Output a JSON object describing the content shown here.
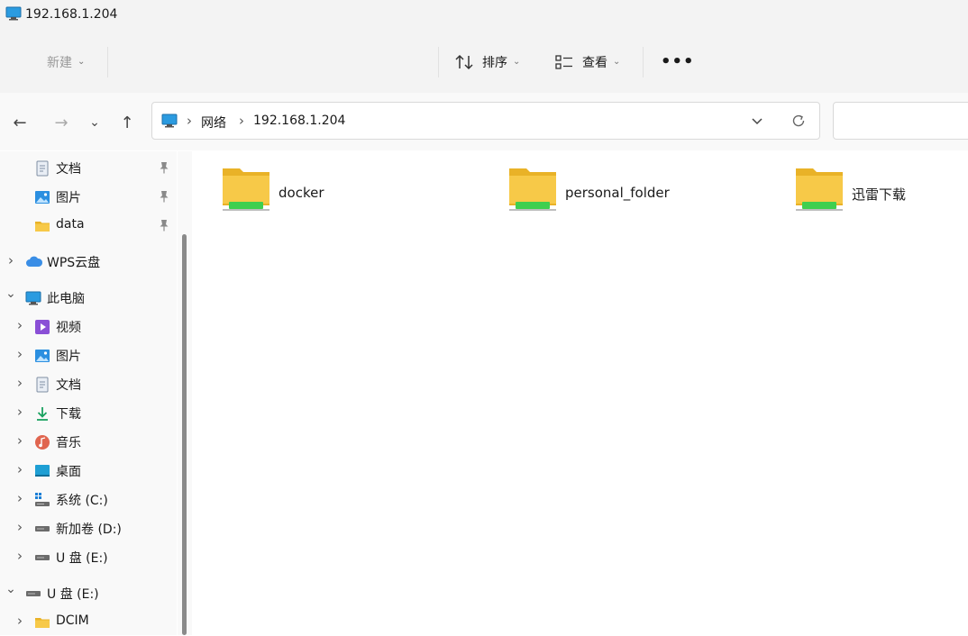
{
  "window": {
    "title": "192.168.1.204"
  },
  "commandbar": {
    "new_label": "新建",
    "sort_label": "排序",
    "view_label": "查看",
    "more_label": "•••"
  },
  "nav": {
    "back": "←",
    "forward": "→",
    "recent": "⌄",
    "up": "↑"
  },
  "address": {
    "crumbs": [
      "网络",
      "192.168.1.204"
    ],
    "separator": "›"
  },
  "search": {
    "placeholder": ""
  },
  "sidebar": {
    "items": [
      {
        "label": "文档",
        "icon": "document-icon",
        "pinned": true
      },
      {
        "label": "图片",
        "icon": "pictures-icon",
        "pinned": true
      },
      {
        "label": "data",
        "icon": "folder-icon",
        "pinned": true
      },
      {
        "label": "WPS云盘",
        "icon": "cloud-icon"
      },
      {
        "label": "此电脑",
        "icon": "computer-icon"
      },
      {
        "label": "视频",
        "icon": "videos-icon"
      },
      {
        "label": "图片",
        "icon": "pictures-icon"
      },
      {
        "label": "文档",
        "icon": "document-icon"
      },
      {
        "label": "下载",
        "icon": "download-icon"
      },
      {
        "label": "音乐",
        "icon": "music-icon"
      },
      {
        "label": "桌面",
        "icon": "desktop-icon"
      },
      {
        "label": "系统 (C:)",
        "icon": "windows-drive-icon"
      },
      {
        "label": "新加卷 (D:)",
        "icon": "drive-icon"
      },
      {
        "label": "U 盘 (E:)",
        "icon": "usb-drive-icon"
      },
      {
        "label": "U 盘 (E:)",
        "icon": "usb-drive-icon"
      },
      {
        "label": "DCIM",
        "icon": "folder-icon"
      }
    ]
  },
  "content": {
    "items": [
      {
        "name": "docker",
        "icon": "network-share-folder-icon"
      },
      {
        "name": "personal_folder",
        "icon": "network-share-folder-icon"
      },
      {
        "name": "迅雷下载",
        "icon": "network-share-folder-icon"
      }
    ]
  },
  "colors": {
    "folder": "#f7c948",
    "folder_back": "#e9b227",
    "share_bar": "#3fcf4f",
    "accent": "#0078d4"
  }
}
